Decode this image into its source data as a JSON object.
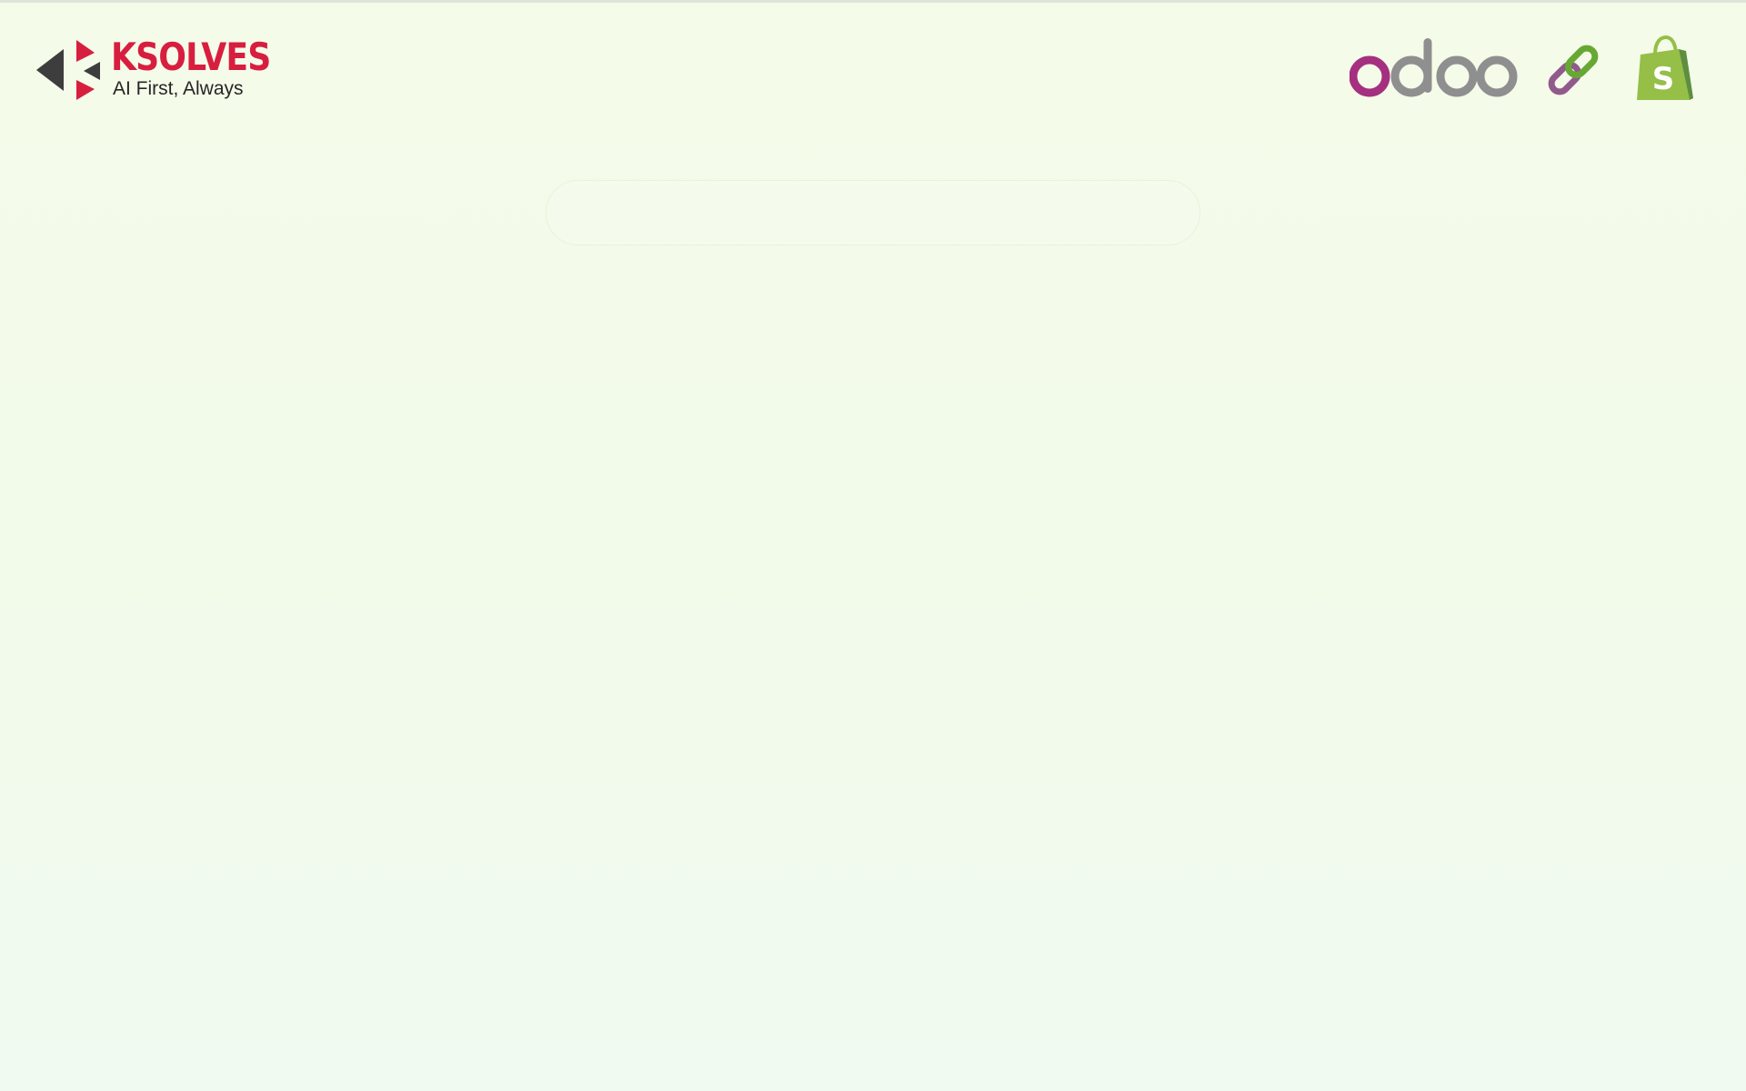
{
  "brand": {
    "name": "KSOLVES",
    "tagline": "AI First, Always",
    "logo_icon": "ksolves-arrow-mark-icon",
    "colors": {
      "primary": "#d81e3f",
      "dark": "#3d3d3d"
    }
  },
  "partners": {
    "odoo": {
      "text": "odoo",
      "icon": "odoo-logo",
      "colors": {
        "purple": "#a4307f",
        "gray": "#8f8f8f"
      }
    },
    "connector": {
      "icon": "chain-link-icon",
      "colors": {
        "green": "#67a834",
        "purple": "#915a8b"
      }
    },
    "shopify": {
      "icon": "shopify-bag-icon",
      "letter": "S",
      "colors": {
        "green": "#95bf47",
        "dark_green": "#5e8e3e"
      }
    }
  },
  "search": {
    "value": "",
    "placeholder": ""
  },
  "page": {
    "background": "#f3fbea"
  }
}
